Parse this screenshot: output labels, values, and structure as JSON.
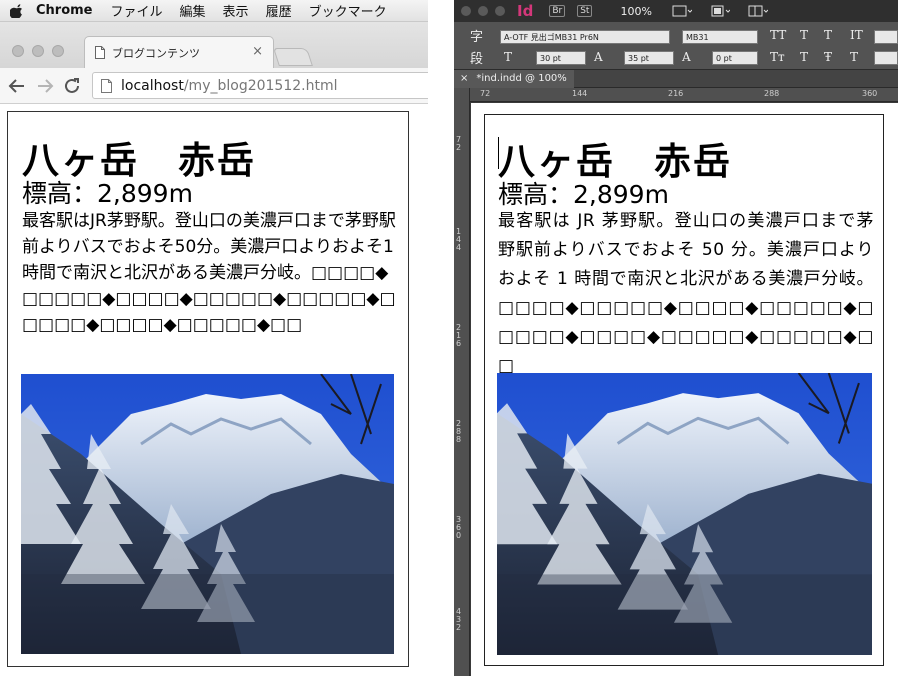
{
  "chrome": {
    "menubar": {
      "app_name": "Chrome",
      "items": [
        "ファイル",
        "編集",
        "表示",
        "履歴",
        "ブックマーク"
      ]
    },
    "tab": {
      "title": "ブログコンテンツ",
      "close": "×"
    },
    "omnibox": {
      "url_host": "localhost",
      "url_path": "/my_blog201512.html"
    },
    "page": {
      "heading": "八ヶ岳　赤岳",
      "subheading": "標高：2,899m",
      "body": "最客駅はJR茅野駅。登山口の美濃戸口まで茅野駅前よりバスでおよそ50分。美濃戸口よりおよそ1時間で南沢と北沢がある美濃戸分岐。□□□□◆□□□□□◆□□□□◆□□□□□◆□□□□□◆□□□□□◆□□□□◆□□□□□◆□□",
      "image_alt": "snowy-mountain-photo"
    }
  },
  "indesign": {
    "app_logo": "Id",
    "bridge_btn": "Br",
    "stock_btn": "St",
    "zoom": "100%",
    "control": {
      "tag_char": "字",
      "tag_para": "段",
      "font_family": "A-OTF 見出ゴMB31 Pr6N",
      "font_style": "MB31",
      "font_size": "30 pt",
      "leading": "35 pt",
      "tracking": "0 pt"
    },
    "doc_tab": {
      "close": "×",
      "title": "*ind.indd @ 100%"
    },
    "ruler_h": [
      "72",
      "144",
      "216",
      "288",
      "360"
    ],
    "ruler_v": [
      "72",
      "144",
      "216",
      "288",
      "360",
      "432"
    ],
    "page": {
      "heading": "八ヶ岳　赤岳",
      "subheading": "標高：2,899m",
      "body": "最客駅は JR 茅野駅。登山口の美濃戸口まで茅野駅前よりバスでおよそ 50 分。美濃戸口よりおよそ 1 時間で南沢と北沢がある美濃戸分岐。□□□□◆□□□□□◆□□□□◆□□□□□◆□□□□□◆□□□□◆□□□□□◆□□□□□◆□□",
      "image_alt": "snowy-mountain-photo"
    }
  }
}
